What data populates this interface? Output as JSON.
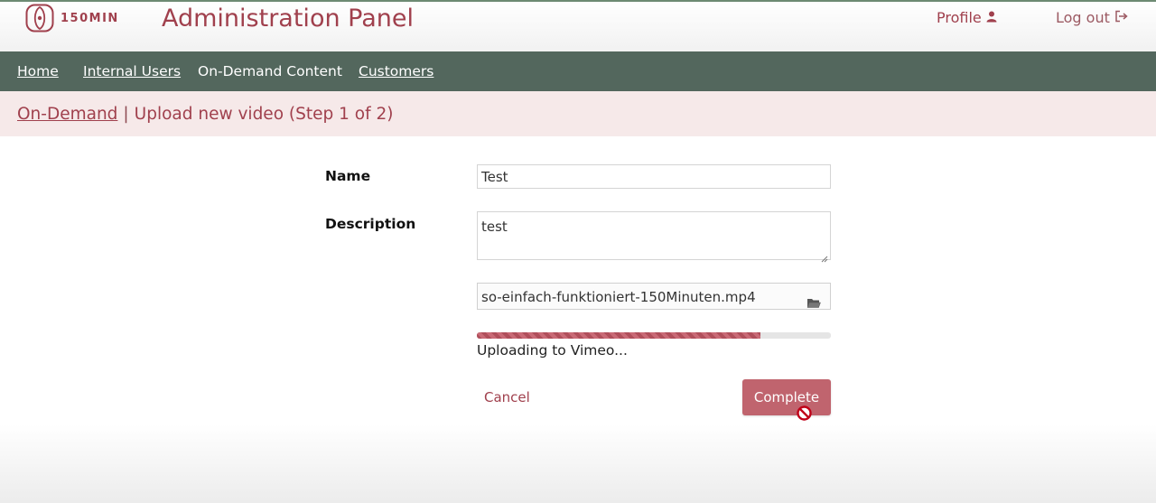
{
  "header": {
    "logo_text": "150MIN",
    "title": "Administration Panel",
    "profile_label": "Profile",
    "logout_label": "Log out",
    "icons": {
      "profile": "user-icon",
      "logout": "sign-out-icon",
      "logo": "150min-logo-icon"
    }
  },
  "nav": {
    "items": [
      {
        "label": "Home"
      },
      {
        "label": "Internal Users"
      },
      {
        "label": "On-Demand Content"
      },
      {
        "label": "Customers"
      }
    ]
  },
  "breadcrumb": {
    "link": "On-Demand",
    "separator": "|",
    "current": "Upload new video (Step 1 of 2)"
  },
  "form": {
    "name_label": "Name",
    "name_value": "Test",
    "description_label": "Description",
    "description_value": "test",
    "file_value": "so-einfach-funktioniert-150Minuten.mp4",
    "file_icon": "folder-open-icon",
    "upload_progress_percent": 80,
    "status_text": "Uploading to Vimeo...",
    "cancel_label": "Cancel",
    "complete_label": "Complete"
  },
  "colors": {
    "brand": "#a0404d",
    "nav_bg": "#53675d",
    "breadcrumb_bg": "#f6e9e9",
    "button_bg": "#c0646e"
  }
}
